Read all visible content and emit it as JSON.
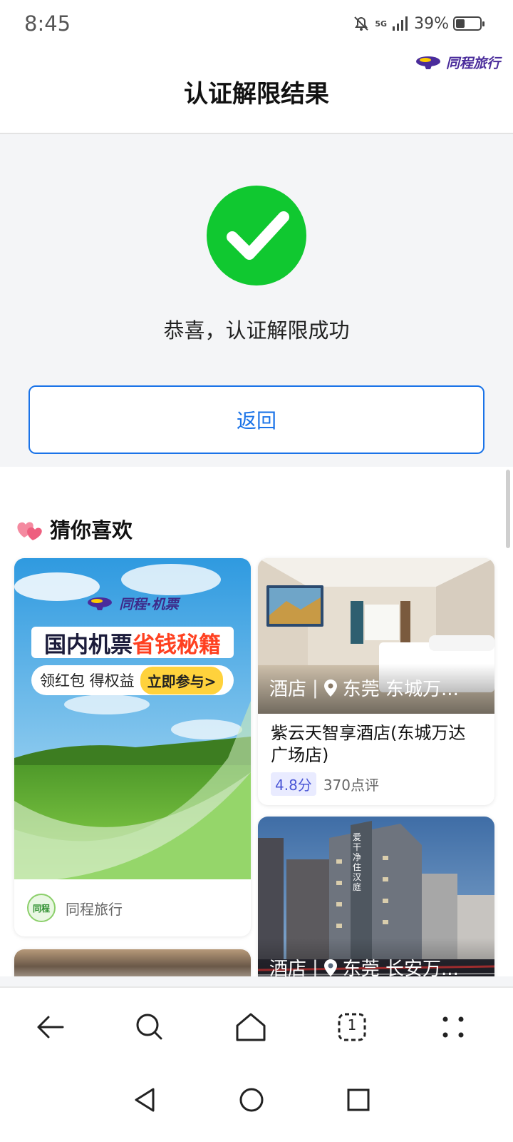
{
  "status_bar": {
    "time": "8:45",
    "network": "5G",
    "battery": "39%",
    "battery_level": 0.39
  },
  "header": {
    "brand": "同程旅行",
    "title": "认证解限结果"
  },
  "result": {
    "message": "恭喜，认证解限成功",
    "back_label": "返回",
    "accent": "#1a73e8",
    "success_color": "#10c830"
  },
  "feed": {
    "title": "猜你喜欢",
    "ad": {
      "logo": "同程·机票",
      "headline_main": "国内机票",
      "headline_highlight": "省钱秘籍",
      "pill_text": "领红包 得权益",
      "cta": "立即参与>",
      "source_avatar": "同程",
      "source_name": "同程旅行"
    },
    "hotels": [
      {
        "tag": "酒店",
        "location": "东莞 东城万...",
        "name": "紫云天智享酒店(东城万达广场店)",
        "score": "4.8分",
        "reviews": "370点评"
      },
      {
        "tag": "酒店",
        "location": "东莞 长安万...",
        "sign": "爱干净 住汉庭"
      }
    ]
  },
  "nav": [
    "back-arrow-icon",
    "search-icon",
    "home-icon",
    "tabs-icon",
    "more-icon"
  ],
  "nav_tab_count": "1"
}
